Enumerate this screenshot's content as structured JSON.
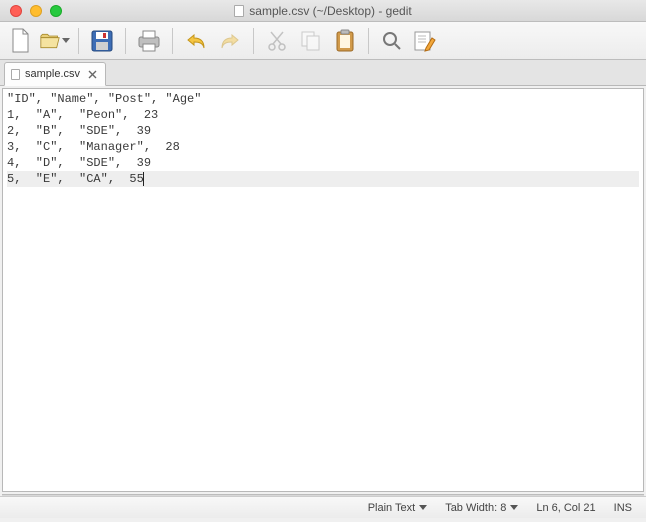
{
  "window": {
    "title": "sample.csv (~/Desktop) - gedit"
  },
  "toolbar": {
    "new": "New",
    "open": "Open",
    "save": "Save",
    "print": "Print",
    "undo": "Undo",
    "redo": "Redo",
    "cut": "Cut",
    "copy": "Copy",
    "paste": "Paste",
    "find": "Find",
    "find_replace": "Find and Replace"
  },
  "tabs": [
    {
      "label": "sample.csv"
    }
  ],
  "editor": {
    "lines": [
      "\"ID\", \"Name\", \"Post\", \"Age\"",
      "1,  \"A\",  \"Peon\",  23",
      "2,  \"B\",  \"SDE\",  39",
      "3,  \"C\",  \"Manager\",  28",
      "4,  \"D\",  \"SDE\",  39",
      "5,  \"E\",  \"CA\",  55"
    ],
    "cursor_line_index": 5
  },
  "status": {
    "language": "Plain Text",
    "tab_width_label": "Tab Width: 8",
    "position": "Ln 6, Col 21",
    "insert_mode": "INS"
  }
}
